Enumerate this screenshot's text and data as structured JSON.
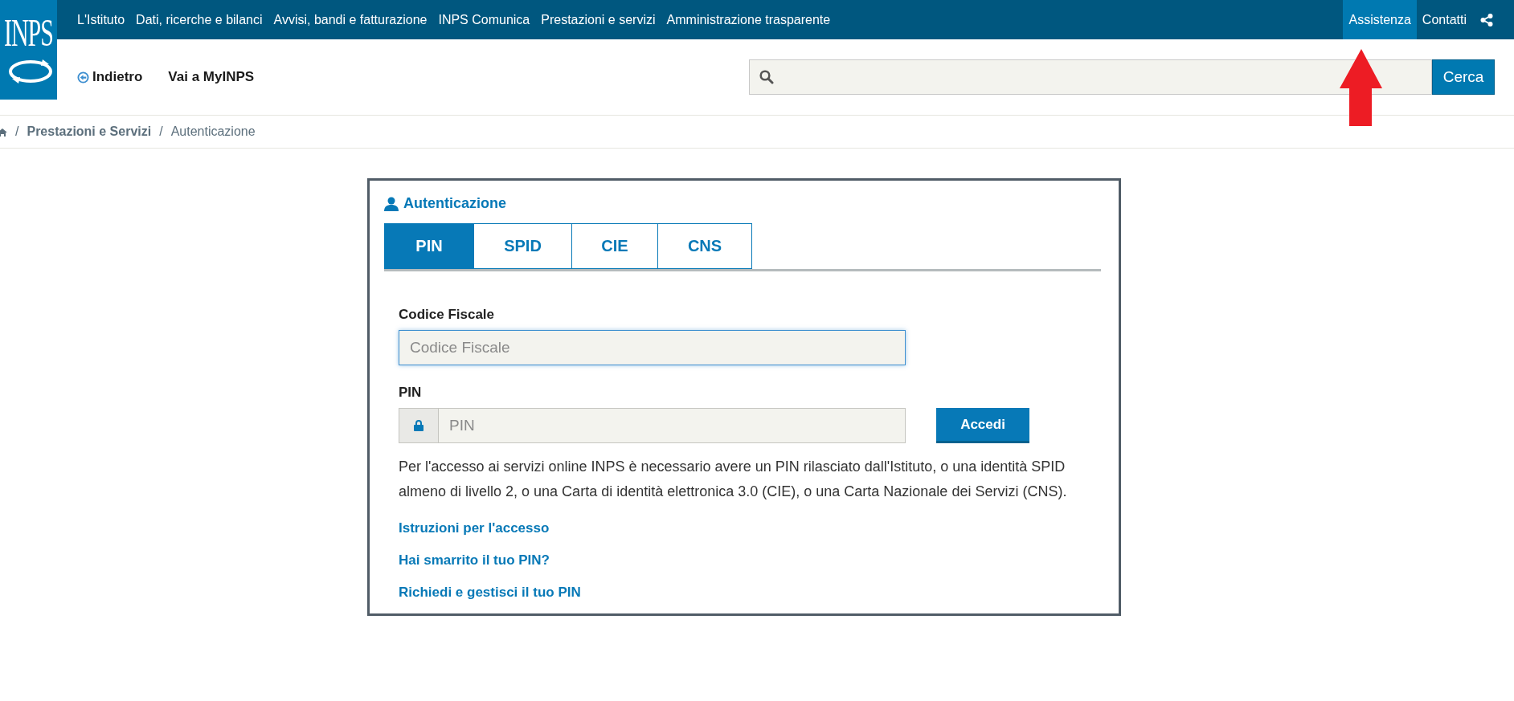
{
  "logo": {
    "text": "INPS"
  },
  "top_nav": {
    "items": [
      {
        "label": "L'Istituto",
        "selected": false
      },
      {
        "label": "Dati, ricerche e bilanci",
        "selected": false
      },
      {
        "label": "Avvisi, bandi e fatturazione",
        "selected": false
      },
      {
        "label": "INPS Comunica",
        "selected": false
      },
      {
        "label": "Prestazioni e servizi",
        "selected": false
      },
      {
        "label": "Amministrazione trasparente",
        "selected": false
      }
    ],
    "right_items": [
      {
        "label": "Assistenza",
        "selected": true
      },
      {
        "label": "Contatti",
        "selected": false
      }
    ]
  },
  "header": {
    "back_link": "Indietro",
    "myinps_link": "Vai a MyINPS",
    "search_button": "Cerca"
  },
  "breadcrumb": {
    "separator": "/",
    "items": [
      {
        "label": "Prestazioni e Servizi",
        "kind": "link"
      },
      {
        "label": "Autenticazione",
        "kind": "current"
      }
    ]
  },
  "auth": {
    "title": "Autenticazione",
    "tabs": [
      {
        "label": "PIN",
        "selected": true
      },
      {
        "label": "SPID",
        "selected": false
      },
      {
        "label": "CIE",
        "selected": false
      },
      {
        "label": "CNS",
        "selected": false
      }
    ],
    "fields": [
      {
        "label": "Codice Fiscale",
        "placeholder": "Codice Fiscale",
        "kind": "text",
        "focused": true
      },
      {
        "label": "PIN",
        "placeholder": "PIN",
        "kind": "password",
        "focused": false
      }
    ],
    "submit": "Accedi",
    "info": "Per l'accesso ai servizi online INPS è necessario avere un PIN rilasciato dall'Istituto, o una identità SPID almeno di livello 2, o una Carta di identità elettronica 3.0 (CIE), o una Carta Nazionale dei Servizi (CNS).",
    "links": [
      "Istruzioni per l'accesso",
      "Hai smarrito il tuo PIN?",
      "Richiedi e gestisci il tuo PIN"
    ]
  }
}
